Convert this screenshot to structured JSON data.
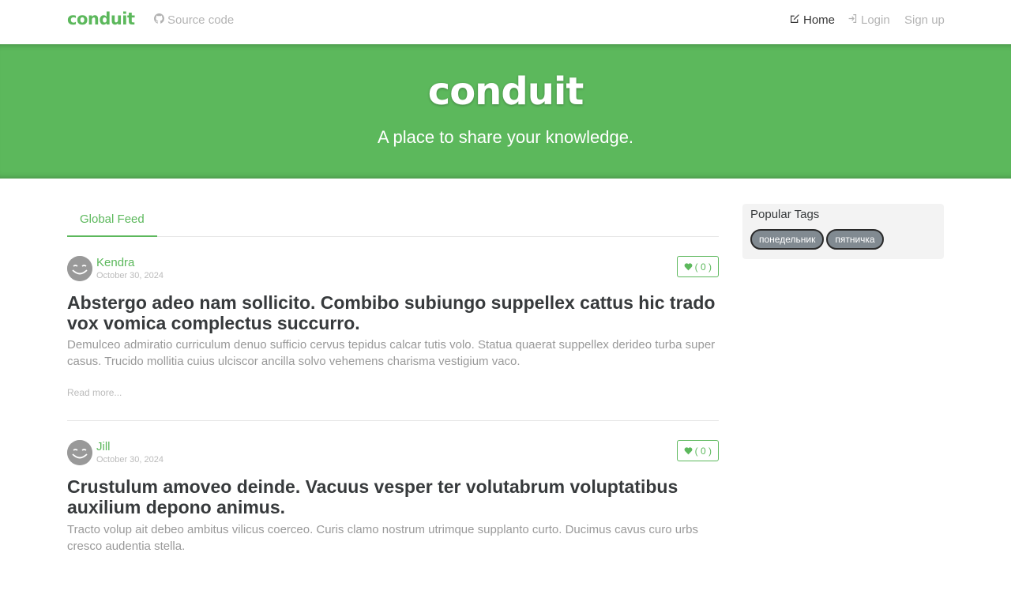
{
  "nav": {
    "brand": "conduit",
    "source_code": "Source code",
    "home": "Home",
    "login": "Login",
    "signup": "Sign up"
  },
  "banner": {
    "title": "conduit",
    "subtitle": "A place to share your knowledge."
  },
  "feed": {
    "tabs": [
      {
        "label": "Global Feed",
        "active": true
      }
    ]
  },
  "articles": [
    {
      "author": "Kendra",
      "date": "October 30, 2024",
      "favorites": "( 0 )",
      "title": "Abstergo adeo nam sollicito. Combibo subiungo suppellex cattus hic trado vox vomica complectus succurro.",
      "description": "Demulceo admiratio curriculum denuo sufficio cervus tepidus calcar tutis volo. Statua quaerat suppellex derideo turba super casus. Trucido mollitia cuius ulciscor ancilla solvo vehemens charisma vestigium vaco.",
      "read_more": "Read more..."
    },
    {
      "author": "Jill",
      "date": "October 30, 2024",
      "favorites": "( 0 )",
      "title": "Crustulum amoveo deinde. Vacuus vesper ter volutabrum voluptatibus auxilium depono animus.",
      "description": "Tracto volup ait debeo ambitus vilicus coerceo. Curis clamo nostrum utrimque supplanto curto. Ducimus cavus curo urbs cresco audentia stella."
    }
  ],
  "sidebar": {
    "title": "Popular Tags",
    "tags": [
      "понедельник",
      "пятничка"
    ]
  },
  "colors": {
    "brand": "#5cb85c",
    "tag_bg": "#818a91",
    "sidebar_bg": "#f3f3f3"
  }
}
